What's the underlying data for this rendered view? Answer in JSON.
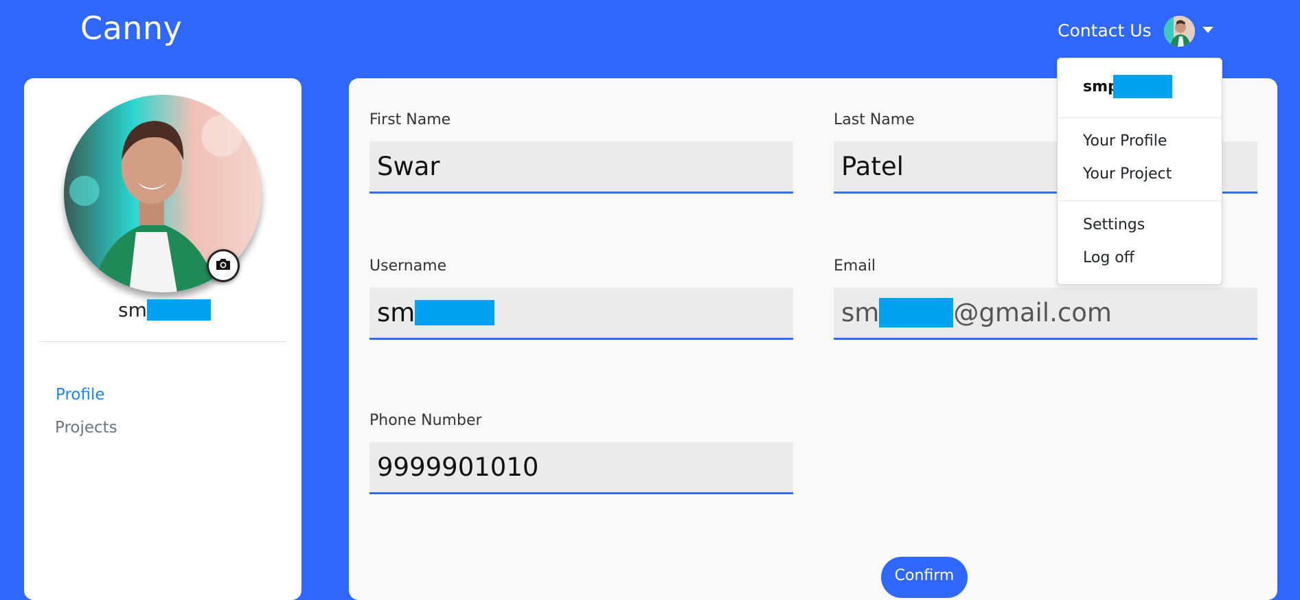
{
  "navbar": {
    "brand": "Canny",
    "contact": "Contact Us"
  },
  "dropdown": {
    "username_prefix": "smp",
    "items": [
      "Your Profile",
      "Your Project",
      "Settings",
      "Log off"
    ]
  },
  "sidebar": {
    "username_prefix": "sm",
    "items": [
      {
        "label": "Profile",
        "active": true
      },
      {
        "label": "Projects",
        "active": false
      }
    ]
  },
  "form": {
    "first_name": {
      "label": "First Name",
      "value": "Swar"
    },
    "last_name": {
      "label": "Last Name",
      "value": "Patel"
    },
    "username": {
      "label": "Username",
      "value_prefix": "sm"
    },
    "email": {
      "label": "Email",
      "value_prefix": "sm",
      "value_suffix": "@gmail.com"
    },
    "phone": {
      "label": "Phone Number",
      "value": "9999901010"
    },
    "confirm": "Confirm"
  },
  "colors": {
    "accent": "#3068fd",
    "link_active": "#1f84f4",
    "redaction": "#00a3ef"
  },
  "icons": [
    "user-avatar-icon",
    "chevron-down-icon",
    "camera-icon"
  ]
}
